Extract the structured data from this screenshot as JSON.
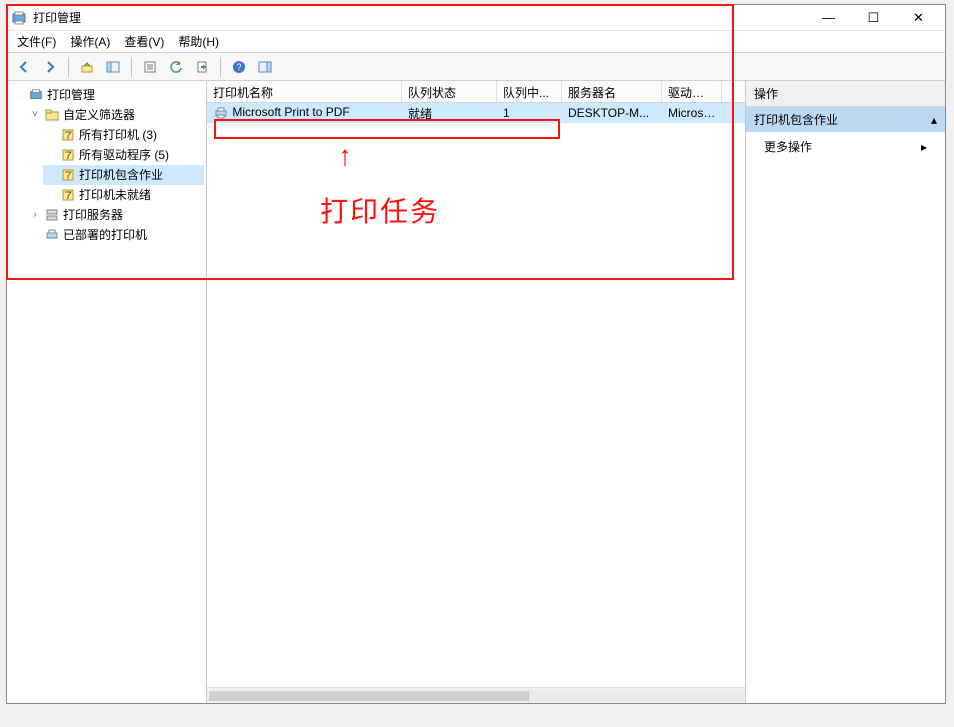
{
  "window": {
    "title": "打印管理"
  },
  "menubar": {
    "file": "文件(F)",
    "action": "操作(A)",
    "view": "查看(V)",
    "help": "帮助(H)"
  },
  "toolbar": {
    "back": "←",
    "forward": "→",
    "up": "↥",
    "show_hide": "▭",
    "props": "☷",
    "refresh": "⟳",
    "export": "↧",
    "help": "?",
    "extra": "▤"
  },
  "tree": {
    "root": "打印管理",
    "custom_filters": "自定义筛选器",
    "all_printers": "所有打印机 (3)",
    "all_drivers": "所有驱动程序 (5)",
    "printers_with_jobs": "打印机包含作业",
    "printers_not_ready": "打印机未就绪",
    "print_servers": "打印服务器",
    "deployed_printers": "已部署的打印机"
  },
  "list": {
    "columns": {
      "name": "打印机名称",
      "queue_status": "队列状态",
      "queue_count": "队列中...",
      "server_name": "服务器名",
      "driver_name": "驱动程序名"
    },
    "rows": [
      {
        "name": "Microsoft Print to PDF",
        "queue_status": "就绪",
        "queue_count": "1",
        "server_name": "DESKTOP-M...",
        "driver_name": "Microsoft"
      }
    ]
  },
  "actions": {
    "header": "操作",
    "section_title": "打印机包含作业",
    "more": "更多操作"
  },
  "annotation": {
    "label": "打印任务"
  }
}
